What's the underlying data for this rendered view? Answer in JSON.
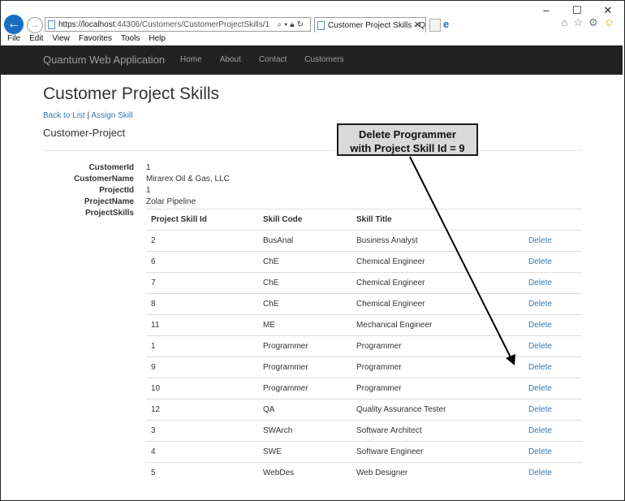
{
  "browser": {
    "window_controls": [
      "–",
      "☐",
      "✕"
    ],
    "address_host": "https://localhost",
    "address_rest": ":44306/Customers/CustomerProjectSkills/1",
    "tab_title": "Customer Project Skills - Q...",
    "menu": [
      "File",
      "Edit",
      "View",
      "Favorites",
      "Tools",
      "Help"
    ]
  },
  "app": {
    "brand": "Quantum Web Application",
    "nav": [
      "Home",
      "About",
      "Contact",
      "Customers"
    ]
  },
  "page": {
    "title": "Customer Project Skills",
    "back_link": "Back to List",
    "separator": "|",
    "assign_link": "Assign Skill",
    "subtitle": "Customer-Project"
  },
  "details": [
    {
      "label": "CustomerId",
      "value": "1"
    },
    {
      "label": "CustomerName",
      "value": "Mirarex Oil & Gas, LLC"
    },
    {
      "label": "ProjectId",
      "value": "1"
    },
    {
      "label": "ProjectName",
      "value": "Zolar Pipeline"
    },
    {
      "label": "ProjectSkills",
      "value": ""
    }
  ],
  "table": {
    "headers": [
      "Project Skill Id",
      "Skill Code",
      "Skill Title",
      ""
    ],
    "delete_label": "Delete",
    "rows": [
      {
        "id": "2",
        "code": "BusAnal",
        "title": "Business Analyst"
      },
      {
        "id": "6",
        "code": "ChE",
        "title": "Chemical Engineer"
      },
      {
        "id": "7",
        "code": "ChE",
        "title": "Chemical Engineer"
      },
      {
        "id": "8",
        "code": "ChE",
        "title": "Chemical Engineer"
      },
      {
        "id": "11",
        "code": "ME",
        "title": "Mechanical Engineer"
      },
      {
        "id": "1",
        "code": "Programmer",
        "title": "Programmer"
      },
      {
        "id": "9",
        "code": "Programmer",
        "title": "Programmer"
      },
      {
        "id": "10",
        "code": "Programmer",
        "title": "Programmer"
      },
      {
        "id": "12",
        "code": "QA",
        "title": "Quality Assurance Tester"
      },
      {
        "id": "3",
        "code": "SWArch",
        "title": "Software Architect"
      },
      {
        "id": "4",
        "code": "SWE",
        "title": "Software Engineer"
      },
      {
        "id": "5",
        "code": "WebDes",
        "title": "Web Designer"
      }
    ]
  },
  "annotation": {
    "line1": "Delete Programmer",
    "line2": "with Project Skill Id = 9"
  },
  "colors": {
    "navbar": "#222222",
    "link": "#337ab7",
    "ie_blue": "#1a6fc2"
  }
}
